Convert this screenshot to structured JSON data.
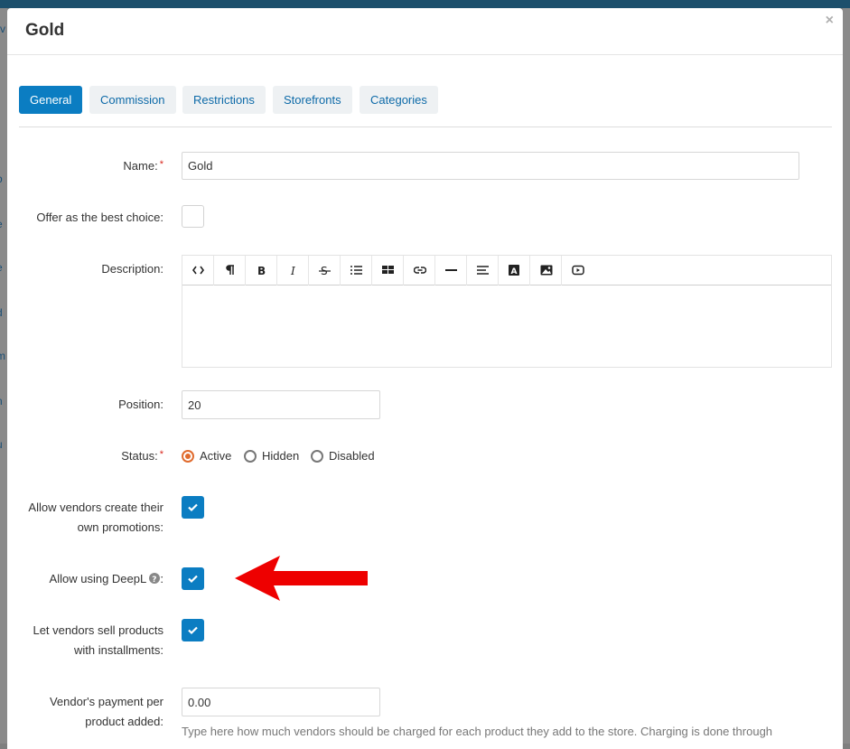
{
  "dialog": {
    "title": "Gold",
    "close_glyph": "×"
  },
  "tabs": [
    {
      "label": "General",
      "active": true
    },
    {
      "label": "Commission",
      "active": false
    },
    {
      "label": "Restrictions",
      "active": false
    },
    {
      "label": "Storefronts",
      "active": false
    },
    {
      "label": "Categories",
      "active": false
    }
  ],
  "form": {
    "name": {
      "label": "Name:",
      "value": "Gold",
      "required": true
    },
    "best_choice": {
      "label": "Offer as the best choice:",
      "checked": false
    },
    "description": {
      "label": "Description:",
      "value": "",
      "toolbar": [
        "code-view-icon",
        "paragraph-icon",
        "bold-icon",
        "italic-icon",
        "strikethrough-icon",
        "unordered-list-icon",
        "table-icon",
        "link-icon",
        "horizontal-rule-icon",
        "align-icon",
        "font-color-icon",
        "image-icon",
        "video-icon"
      ]
    },
    "position": {
      "label": "Position:",
      "value": "20"
    },
    "status": {
      "label": "Status:",
      "required": true,
      "options": [
        {
          "label": "Active",
          "selected": true
        },
        {
          "label": "Hidden",
          "selected": false
        },
        {
          "label": "Disabled",
          "selected": false
        }
      ]
    },
    "vendor_promotions": {
      "label_line1": "Allow vendors create their",
      "label_line2": "own promotions:",
      "checked": true
    },
    "deepl": {
      "label": "Allow using DeepL",
      "label_suffix": ":",
      "checked": true
    },
    "installments": {
      "label_line1": "Let vendors sell products",
      "label_line2": "with installments:",
      "checked": true
    },
    "payment_per_product": {
      "label_line1": "Vendor's payment per",
      "label_line2": "product added:",
      "value": "0.00",
      "help": "Type here how much vendors should be charged for each product they add to the store. Charging is done through"
    }
  },
  "background_fragments": [
    "rv",
    "b",
    "e",
    "e",
    "d",
    "m",
    "n",
    "u"
  ],
  "colors": {
    "accent": "#0b7dc2",
    "required": "#d9281f",
    "radio_selected": "#e06b2d",
    "annotation_arrow": "#ee0000"
  }
}
